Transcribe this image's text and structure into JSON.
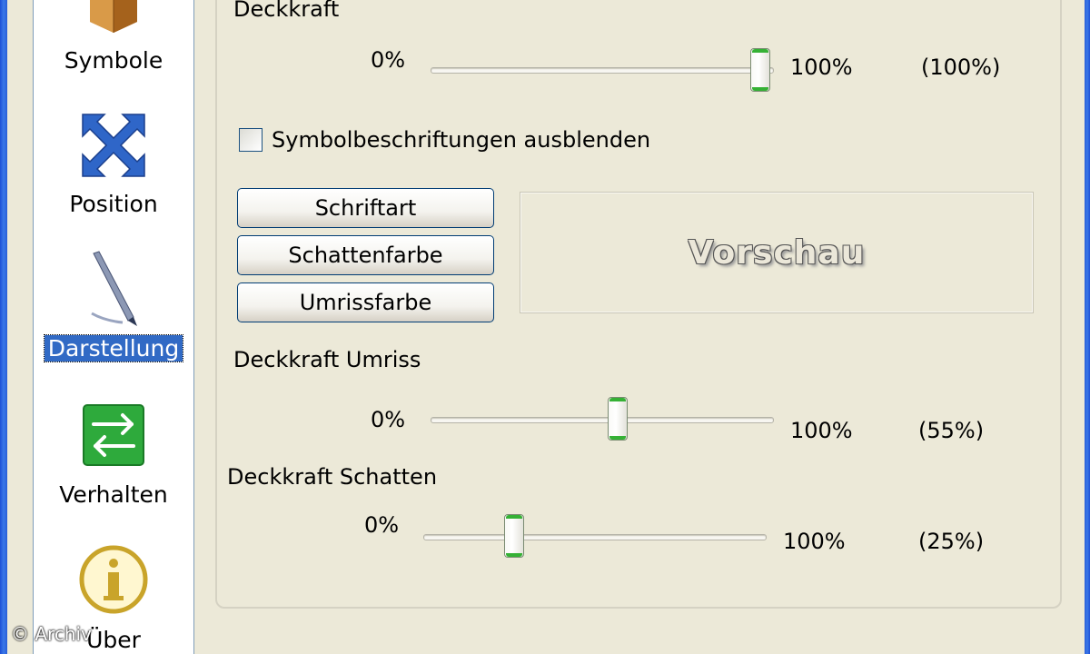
{
  "sidebar": {
    "items": [
      {
        "label": "Symbole",
        "icon": "box-icon"
      },
      {
        "label": "Position",
        "icon": "move-arrows-icon"
      },
      {
        "label": "Darstellung",
        "icon": "pen-icon",
        "selected": true
      },
      {
        "label": "Verhalten",
        "icon": "swap-arrows-icon"
      },
      {
        "label": "Über",
        "icon": "info-icon"
      }
    ]
  },
  "main": {
    "opacity": {
      "label": "Deckkraft",
      "min_label": "0%",
      "max_label": "100%",
      "value_display": "(100%)",
      "value": 100
    },
    "hide_labels_checkbox": {
      "label": "Symbolbeschriftungen ausblenden",
      "checked": false
    },
    "buttons": {
      "font": "Schriftart",
      "shadow_color": "Schattenfarbe",
      "outline_color": "Umrissfarbe"
    },
    "preview": {
      "text": "Vorschau"
    },
    "outline_opacity": {
      "label": "Deckkraft Umriss",
      "min_label": "0%",
      "max_label": "100%",
      "value_display": "(55%)",
      "value": 55
    },
    "shadow_opacity": {
      "label": "Deckkraft Schatten",
      "min_label": "0%",
      "max_label": "100%",
      "value_display": "(25%)",
      "value": 25
    }
  },
  "watermark": "© Archiv",
  "colors": {
    "selection": "#316ac5",
    "slider_accent": "#35b135",
    "window_border": "#2a5fd8"
  }
}
